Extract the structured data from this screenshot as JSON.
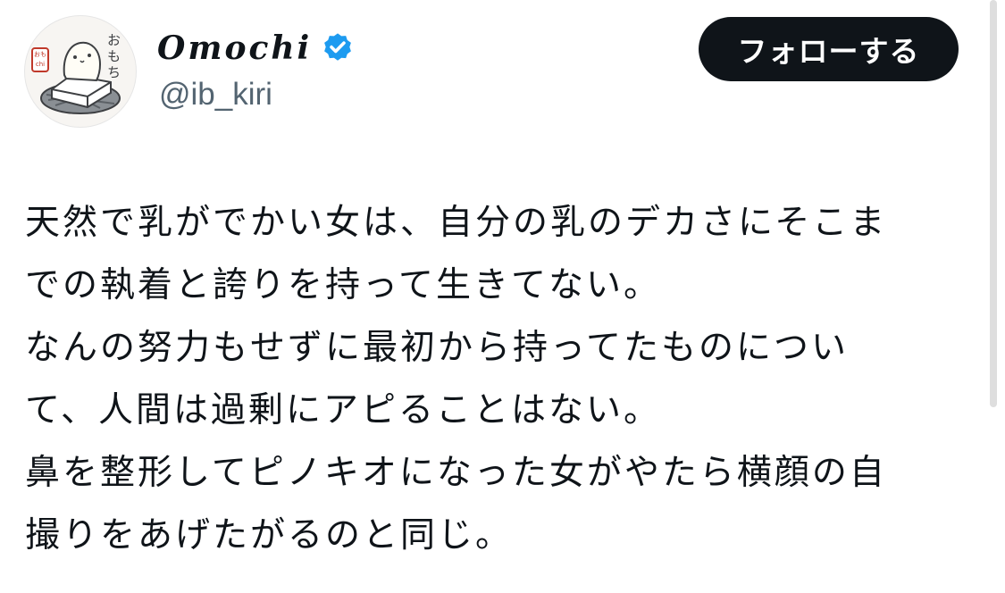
{
  "author": {
    "display_name": "Omochi",
    "handle": "@ib_kiri",
    "avatar_label": "おもち",
    "stamp_label": "おもchi",
    "verified_icon": "verified-badge-icon"
  },
  "actions": {
    "follow_label": "フォローする"
  },
  "tweet": {
    "lines": [
      "天然で乳がでかい女は、自分の乳のデカさにそこま",
      "での執着と誇りを持って生きてない。",
      "なんの努力もせずに最初から持ってたものについ",
      "て、人間は過剰にアピることはない。",
      "鼻を整形してピノキオになった女がやたら横顔の自",
      "撮りをあげたがるのと同じ。"
    ]
  },
  "colors": {
    "text": "#0f1419",
    "secondary_text": "#536471",
    "verified": "#1d9bf0",
    "button_bg": "#0f1419",
    "button_text": "#ffffff",
    "stamp_red": "#c0392b"
  }
}
